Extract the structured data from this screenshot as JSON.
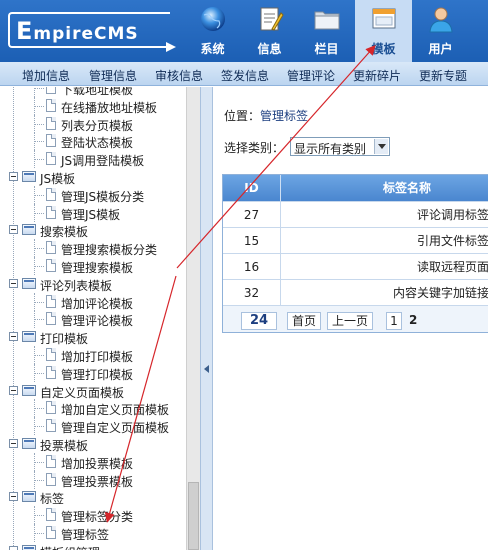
{
  "brand": {
    "text_big": "E",
    "text_rest": "mpireCMS"
  },
  "nav": [
    {
      "id": "system",
      "label": "系统",
      "icon": "globe-icon"
    },
    {
      "id": "info",
      "label": "信息",
      "icon": "notepad-icon"
    },
    {
      "id": "column",
      "label": "栏目",
      "icon": "folder-icon"
    },
    {
      "id": "template",
      "label": "模板",
      "icon": "window-icon",
      "active": true
    },
    {
      "id": "user",
      "label": "用户",
      "icon": "user-icon"
    }
  ],
  "submenu": [
    "增加信息",
    "管理信息",
    "审核信息",
    "签发信息",
    "管理评论",
    "更新碎片",
    "更新专题"
  ],
  "tree": {
    "rows": [
      {
        "kind": "doc",
        "label": "下载地址模板"
      },
      {
        "kind": "doc",
        "label": "在线播放地址模板"
      },
      {
        "kind": "doc",
        "label": "列表分页模板"
      },
      {
        "kind": "doc",
        "label": "登陆状态模板"
      },
      {
        "kind": "doc",
        "label": "JS调用登陆模板"
      },
      {
        "kind": "folder",
        "label": "JS模板"
      },
      {
        "kind": "doc",
        "label": "管理JS模板分类"
      },
      {
        "kind": "doc",
        "label": "管理JS模板"
      },
      {
        "kind": "folder",
        "label": "搜索模板"
      },
      {
        "kind": "doc",
        "label": "管理搜索模板分类"
      },
      {
        "kind": "doc",
        "label": "管理搜索模板"
      },
      {
        "kind": "folder",
        "label": "评论列表模板"
      },
      {
        "kind": "doc",
        "label": "增加评论模板"
      },
      {
        "kind": "doc",
        "label": "管理评论模板"
      },
      {
        "kind": "folder",
        "label": "打印模板"
      },
      {
        "kind": "doc",
        "label": "增加打印模板"
      },
      {
        "kind": "doc",
        "label": "管理打印模板"
      },
      {
        "kind": "folder",
        "label": "自定义页面模板"
      },
      {
        "kind": "doc",
        "label": "增加自定义页面模板"
      },
      {
        "kind": "doc",
        "label": "管理自定义页面模板"
      },
      {
        "kind": "folder",
        "label": "投票模板"
      },
      {
        "kind": "doc",
        "label": "增加投票模板"
      },
      {
        "kind": "doc",
        "label": "管理投票模板"
      },
      {
        "kind": "folder",
        "label": "标签"
      },
      {
        "kind": "doc",
        "label": "管理标签分类"
      },
      {
        "kind": "doc",
        "label": "管理标签"
      },
      {
        "kind": "folder",
        "label": "模板组管理"
      }
    ]
  },
  "main": {
    "location_label": "位置：",
    "location_link": "管理标签",
    "filter_label": "选择类别：",
    "filter_value": "显示所有类别",
    "table": {
      "headers": [
        "ID",
        "标签名称"
      ],
      "rows": [
        {
          "id": "27",
          "name": "评论调用标签"
        },
        {
          "id": "15",
          "name": "引用文件标签"
        },
        {
          "id": "16",
          "name": "读取远程页面"
        },
        {
          "id": "32",
          "name": "内容关键字加链接"
        }
      ],
      "total": "24",
      "first_label": "首页",
      "prev_label": "上一页",
      "current_page": "1",
      "next_page": "2"
    }
  },
  "colors": {
    "header": "#2f74c9",
    "annotation": "#d6262b",
    "link": "#1d3f80"
  }
}
